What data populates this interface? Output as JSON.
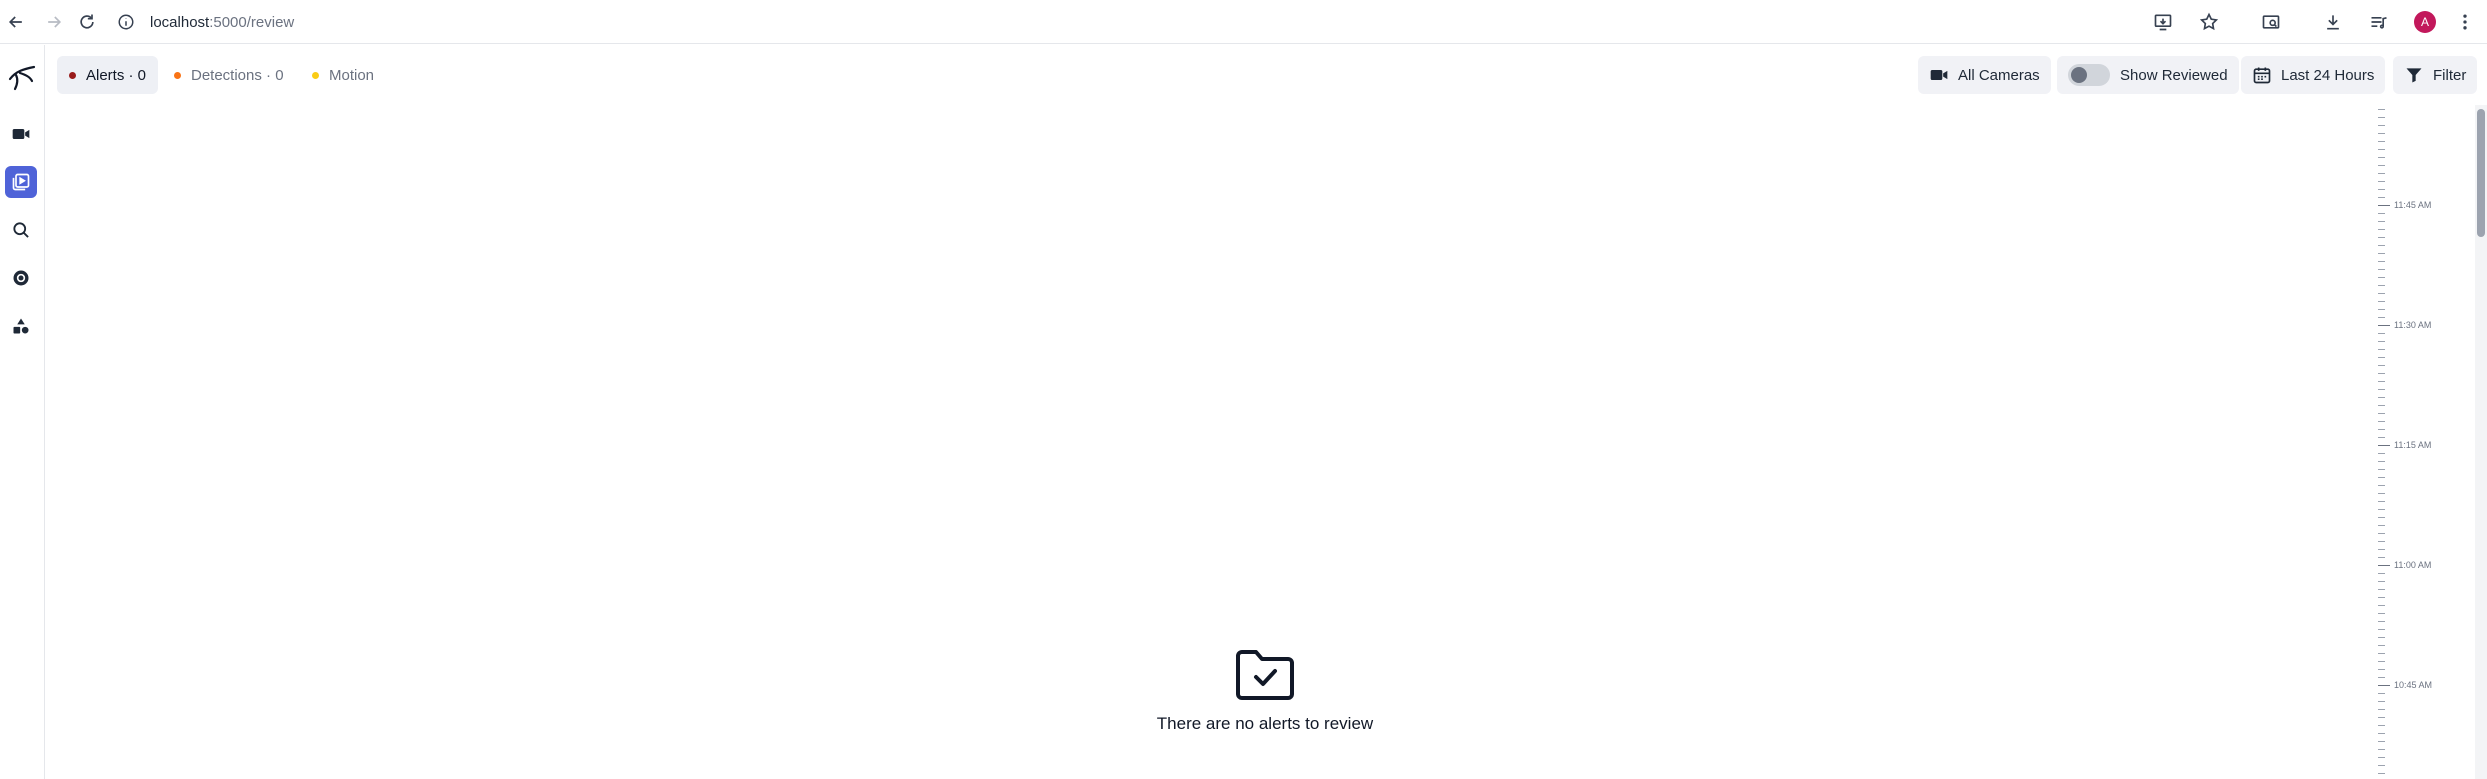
{
  "browser": {
    "url_host": "localhost",
    "url_path": ":5000/review",
    "profile_initial": "A"
  },
  "sidebar": {
    "items": [
      {
        "name": "live",
        "icon": "video-camera-icon"
      },
      {
        "name": "review",
        "icon": "review-play-icon",
        "active": true
      },
      {
        "name": "explore",
        "icon": "search-icon"
      },
      {
        "name": "export",
        "icon": "record-icon"
      },
      {
        "name": "settings",
        "icon": "shapes-icon"
      }
    ]
  },
  "toolbar": {
    "tabs": [
      {
        "label": "Alerts · 0",
        "color": "#991b1b",
        "active": true
      },
      {
        "label": "Detections · 0",
        "color": "#f97316",
        "active": false
      },
      {
        "label": "Motion",
        "color": "#facc15",
        "active": false
      }
    ],
    "cameras_label": "All Cameras",
    "show_reviewed_label": "Show Reviewed",
    "show_reviewed_on": false,
    "range_label": "Last 24 Hours",
    "filter_label": "Filter"
  },
  "timeline": {
    "labels": [
      "11:45 AM",
      "11:30 AM",
      "11:15 AM",
      "11:00 AM",
      "10:45 AM"
    ]
  },
  "empty_state": {
    "message": "There are no alerts to review",
    "icon": "folder-check-icon"
  }
}
